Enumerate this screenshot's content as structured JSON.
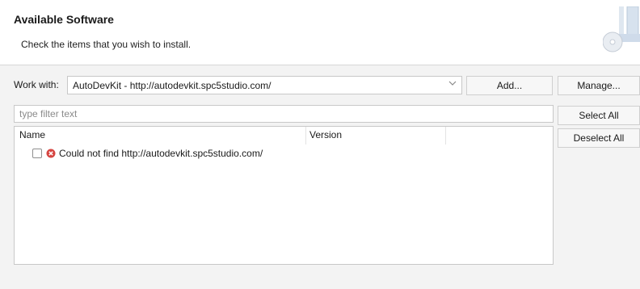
{
  "header": {
    "title": "Available Software",
    "subtitle": "Check the items that you wish to install.",
    "image_icon": "install-wizard-icon"
  },
  "work_with": {
    "label": "Work with:",
    "value": "AutoDevKit - http://autodevkit.spc5studio.com/",
    "dropdown_icon": "chevron-down-icon"
  },
  "buttons": {
    "add": "Add...",
    "manage": "Manage...",
    "select_all": "Select All",
    "deselect_all": "Deselect All"
  },
  "filter": {
    "placeholder": "type filter text"
  },
  "table": {
    "columns": [
      "Name",
      "Version"
    ],
    "rows": [
      {
        "checked": false,
        "icon": "error-icon",
        "name": "Could not find http://autodevkit.spc5studio.com/",
        "version": ""
      }
    ]
  },
  "colors": {
    "error": "#d64541",
    "border": "#c8c8c8",
    "panel_bg": "#f3f3f3"
  }
}
